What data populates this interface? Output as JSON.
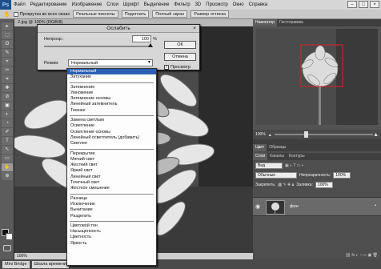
{
  "menubar": {
    "logo": "Ps",
    "items": [
      "Файл",
      "Редактирование",
      "Изображение",
      "Слои",
      "Шрифт",
      "Выделение",
      "Фильтр",
      "3D",
      "Просмотр",
      "Окно",
      "Справка"
    ],
    "controls": [
      "–",
      "□",
      "×"
    ]
  },
  "optionsbar": {
    "checkbox_label": "Прокрутка во всех окнах",
    "buttons": [
      "Реальные пикселы",
      "Подогнать",
      "Полный экран",
      "Размер оттиска"
    ]
  },
  "document": {
    "tab": "2.jpg @ 100% (RGB/8)",
    "status": "100%",
    "zoom_box": "100%"
  },
  "bottombar": [
    "Mini Bridge",
    "Шкала времени"
  ],
  "dialog": {
    "title": "Ослабить",
    "opacity_label": "Непрозр.:",
    "opacity_value": "100",
    "opacity_unit": "%",
    "mode_label": "Режим:",
    "mode_value": "Нормальный",
    "ok": "ОК",
    "cancel": "Отмена",
    "preview_label": "Просмотр",
    "close": "×"
  },
  "blend_modes": [
    [
      "Нормальный",
      "Затухание"
    ],
    [
      "Затемнение",
      "Умножение",
      "Затемнение основы",
      "Линейный затемнитель",
      "Темнее"
    ],
    [
      "Замена светлым",
      "Осветление",
      "Осветление основы",
      "Линейный осветлитель (добавить)",
      "Светлее"
    ],
    [
      "Перекрытие",
      "Мягкий свет",
      "Жесткий свет",
      "Яркий свет",
      "Линейный свет",
      "Точечный свет",
      "Жесткое смешение"
    ],
    [
      "Разница",
      "Исключение",
      "Вычитание",
      "Разделить"
    ],
    [
      "Цветовой тон",
      "Насыщенность",
      "Цветность",
      "Яркость"
    ]
  ],
  "navigator": {
    "tabs": [
      "Навигатор",
      "Гистограмма"
    ],
    "zoom": "100%"
  },
  "layers": {
    "tabs": [
      "Слои",
      "Каналы",
      "Контуры"
    ],
    "top_tabs": [
      "Цвет",
      "Образцы"
    ],
    "kind_label": "Вид",
    "blend": "Обычные",
    "opacity_label": "Непрозрачность:",
    "opacity_value": "100%",
    "lock_label": "Закрепить:",
    "fill_label": "Заливка:",
    "fill_value": "100%",
    "layer_name": "фон"
  },
  "tools": [
    "▸",
    "⬚",
    "ʘ",
    "✎",
    "⌖",
    "✂",
    "⌗",
    "✚",
    "⊘",
    "▣",
    "◐",
    "◔",
    "✐",
    "T",
    "↖",
    "▭",
    "✋",
    "⊕"
  ]
}
